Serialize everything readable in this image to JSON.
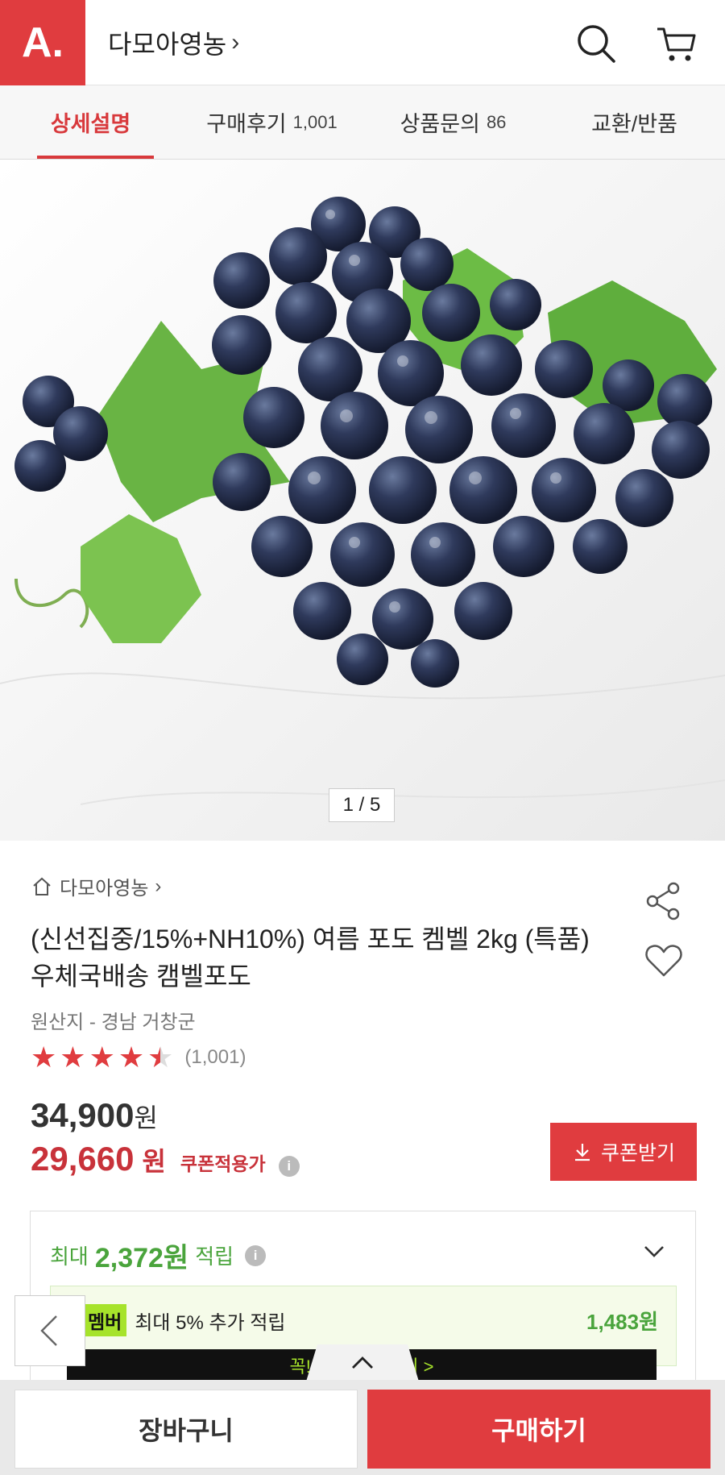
{
  "header": {
    "logo_text": "A.",
    "store_name": "다모아영농",
    "chevron": "›",
    "icons": [
      "search-icon",
      "cart-icon"
    ]
  },
  "tabs": [
    {
      "label": "상세설명",
      "count": "",
      "active": true
    },
    {
      "label": "구매후기",
      "count": "1,001",
      "active": false
    },
    {
      "label": "상품문의",
      "count": "86",
      "active": false
    },
    {
      "label": "교환/반품",
      "count": "",
      "active": false
    }
  ],
  "gallery": {
    "pager": "1 / 5"
  },
  "product": {
    "breadcrumb": "다모아영농",
    "breadcrumb_chevron": "›",
    "title": "(신선집중/15%+NH10%) 여름 포도 켐벨 2kg (특품) 우체국배송 캠벨포도",
    "origin": "원산지 - 경남 거창군",
    "rating_value": 4.5,
    "rating_count": "(1,001)"
  },
  "price": {
    "original": "34,900",
    "won": "원",
    "sale": "29,660",
    "sale_label": "쿠폰적용가",
    "coupon_button": "쿠폰받기",
    "info_icon": "i"
  },
  "points": {
    "prefix": "최대",
    "amount": "2,372원",
    "suffix": "적립",
    "member_badge": "멤버",
    "member_text": "최대 5% 추가 적립",
    "member_amount": "1,483원",
    "member_bar": "꼭! 시작하고 받기 >"
  },
  "bottom": {
    "cart": "장바구니",
    "buy": "구매하기"
  },
  "colors": {
    "brand": "#e03c3f",
    "sale": "#c8323a",
    "points": "#4aa43c",
    "member": "#a6e32b"
  }
}
